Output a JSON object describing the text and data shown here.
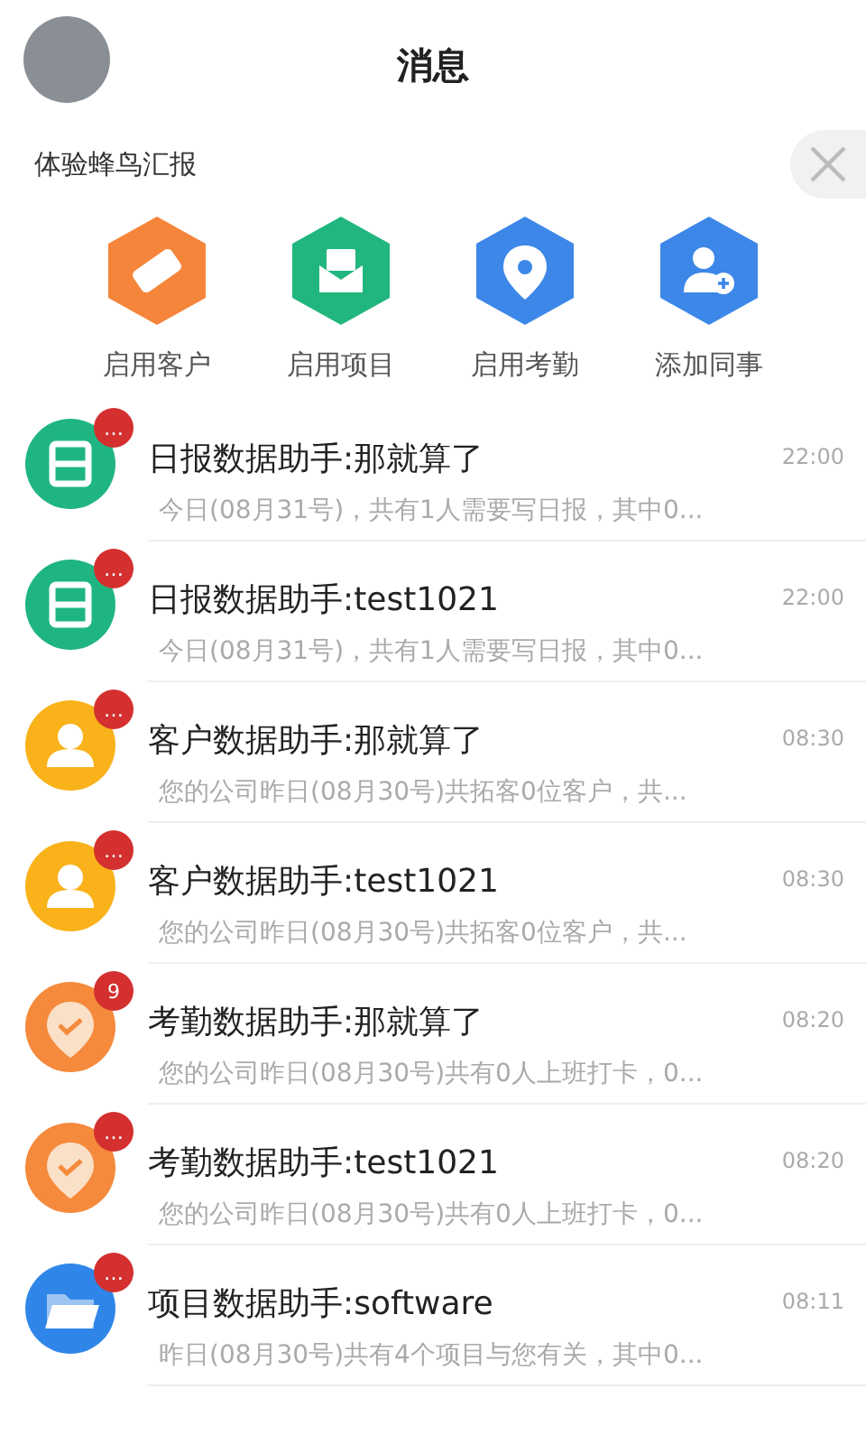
{
  "header": {
    "title": "消息"
  },
  "promo": {
    "title": "体验蜂鸟汇报",
    "actions": [
      {
        "kind": "customer",
        "label": "启用客户"
      },
      {
        "kind": "project",
        "label": "启用项目"
      },
      {
        "kind": "attendance",
        "label": "启用考勤"
      },
      {
        "kind": "colleague",
        "label": "添加同事"
      }
    ]
  },
  "messages": [
    {
      "kind": "daily",
      "badge": "…",
      "title": "日报数据助手:那就算了",
      "time": "22:00",
      "preview": "今日(08月31号)，共有1人需要写日报，其中0..."
    },
    {
      "kind": "daily",
      "badge": "…",
      "title": "日报数据助手:test1021",
      "time": "22:00",
      "preview": "今日(08月31号)，共有1人需要写日报，其中0..."
    },
    {
      "kind": "customer",
      "badge": "…",
      "title": "客户数据助手:那就算了",
      "time": "08:30",
      "preview": "您的公司昨日(08月30号)共拓客0位客户，共..."
    },
    {
      "kind": "customer",
      "badge": "…",
      "title": "客户数据助手:test1021",
      "time": "08:30",
      "preview": "您的公司昨日(08月30号)共拓客0位客户，共..."
    },
    {
      "kind": "attendance",
      "badge": "9",
      "title": "考勤数据助手:那就算了",
      "time": "08:20",
      "preview": "您的公司昨日(08月30号)共有0人上班打卡，0..."
    },
    {
      "kind": "attendance",
      "badge": "…",
      "title": "考勤数据助手:test1021",
      "time": "08:20",
      "preview": "您的公司昨日(08月30号)共有0人上班打卡，0..."
    },
    {
      "kind": "project",
      "badge": "…",
      "title": "项目数据助手:software",
      "time": "08:11",
      "preview": "昨日(08月30号)共有4个项目与您有关，其中0..."
    }
  ]
}
